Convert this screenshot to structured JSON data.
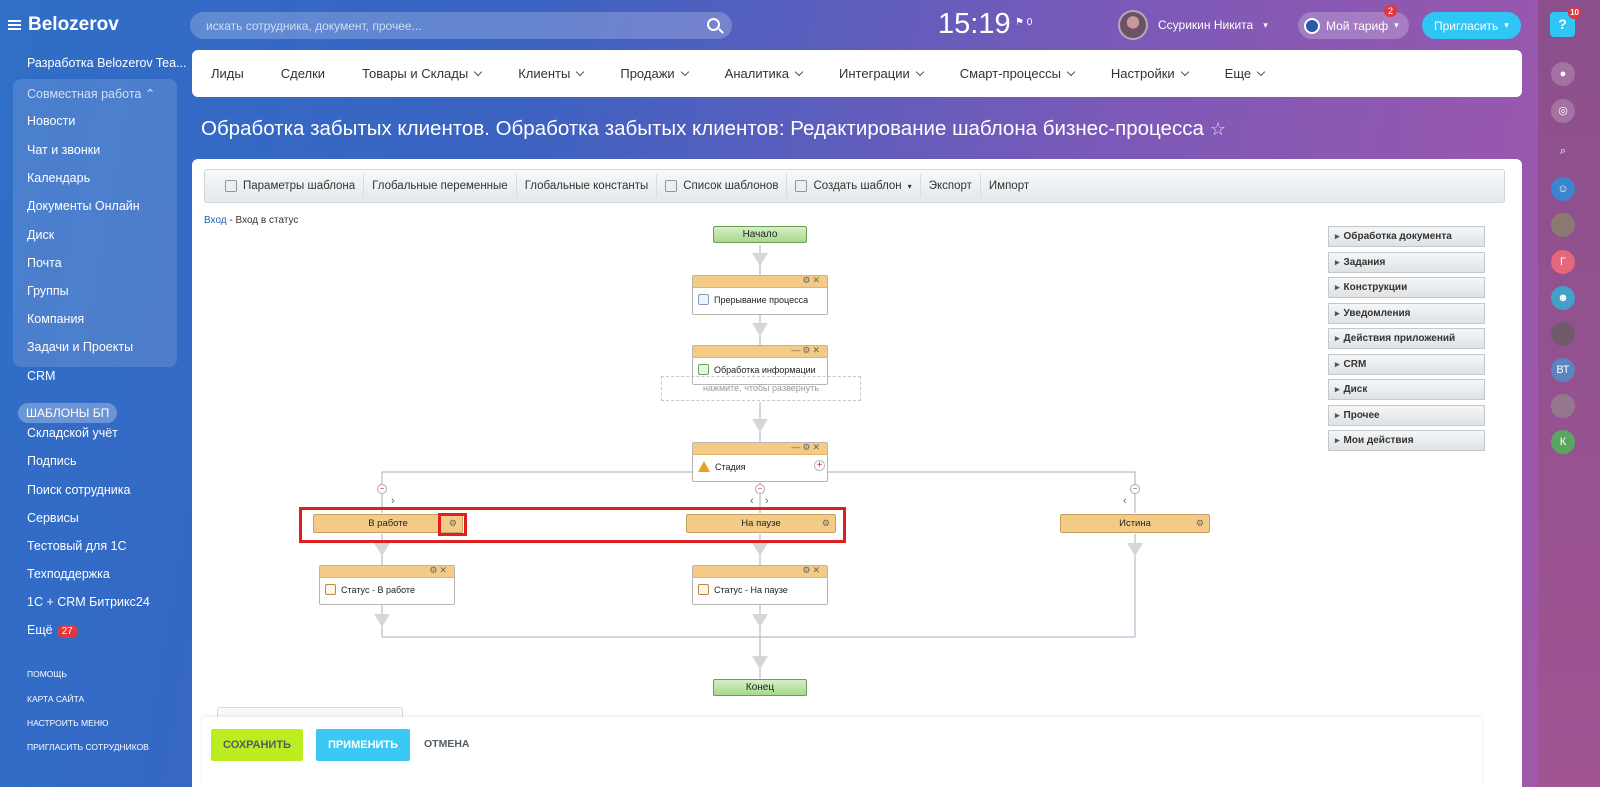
{
  "app": {
    "logo": "Belozerov"
  },
  "sidebar": {
    "items": [
      {
        "label": "Разработка Belozerov Tea..."
      },
      {
        "label": "Совместная работа"
      },
      {
        "label": "Новости"
      },
      {
        "label": "Чат и звонки"
      },
      {
        "label": "Календарь"
      },
      {
        "label": "Документы Онлайн"
      },
      {
        "label": "Диск"
      },
      {
        "label": "Почта"
      },
      {
        "label": "Группы"
      },
      {
        "label": "Компания"
      },
      {
        "label": "Задачи и Проекты"
      },
      {
        "label": "CRM"
      },
      {
        "label": "ШАБЛОНЫ БП"
      },
      {
        "label": "Складской учёт"
      },
      {
        "label": "Подпись"
      },
      {
        "label": "Поиск сотрудника"
      },
      {
        "label": "Сервисы"
      },
      {
        "label": "Тестовый для 1С"
      },
      {
        "label": "Техподдержка"
      },
      {
        "label": "1С + CRM Битрикс24"
      },
      {
        "label": "Ещё",
        "badge": "27"
      }
    ],
    "footer_links": [
      "ПОМОЩЬ",
      "КАРТА САЙТА",
      "НАСТРОИТЬ МЕНЮ",
      "ПРИГЛАСИТЬ СОТРУДНИКОВ"
    ]
  },
  "header": {
    "search_placeholder": "искать сотрудника, документ, прочее...",
    "time": "15:19",
    "flag_count": "0",
    "user_name": "Ссурикин Никита",
    "tariff_label": "Мой тариф",
    "tariff_badge": "2",
    "invite_label": "Пригласить"
  },
  "rail": {
    "help_badge": "10",
    "avatars": [
      "Г",
      "ВТ",
      "К"
    ]
  },
  "topnav": {
    "items": [
      {
        "label": "Лиды",
        "dropdown": false
      },
      {
        "label": "Сделки",
        "dropdown": false
      },
      {
        "label": "Товары и Склады",
        "dropdown": true
      },
      {
        "label": "Клиенты",
        "dropdown": true
      },
      {
        "label": "Продажи",
        "dropdown": true
      },
      {
        "label": "Аналитика",
        "dropdown": true
      },
      {
        "label": "Интеграции",
        "dropdown": true
      },
      {
        "label": "Смарт-процессы",
        "dropdown": true
      },
      {
        "label": "Настройки",
        "dropdown": true
      },
      {
        "label": "Еще",
        "dropdown": true
      }
    ]
  },
  "page": {
    "title": "Обработка забытых клиентов. Обработка забытых клиентов: Редактирование шаблона бизнес-процесса"
  },
  "toolbar": {
    "items": [
      "Параметры шаблона",
      "Глобальные переменные",
      "Глобальные константы",
      "Список шаблонов",
      "Создать шаблон",
      "Экспорт",
      "Импорт"
    ]
  },
  "breadcrumb": {
    "link": "Вход",
    "separator": " - ",
    "current": "Вход в статус"
  },
  "palette": {
    "groups": [
      "Обработка документа",
      "Задания",
      "Конструкции",
      "Уведомления",
      "Действия приложений",
      "CRM",
      "Диск",
      "Прочее",
      "Мои действия"
    ]
  },
  "diagram": {
    "start": "Начало",
    "end": "Конец",
    "activities": {
      "interrupt": "Прерывание процесса",
      "info": "Обработка информации",
      "expand_hint": "нажмите, чтобы развернуть",
      "stage": "Стадия",
      "status_work": "Статус - В работе",
      "status_pause": "Статус - На паузе"
    },
    "branches": [
      "В работе",
      "На паузе",
      "Истина"
    ]
  },
  "footer": {
    "save": "СОХРАНИТЬ",
    "apply": "ПРИМЕНИТЬ",
    "cancel": "ОТМЕНА"
  },
  "colors": {
    "accent_green": "#bbed21",
    "accent_blue": "#3bc8f5",
    "highlight_red": "#e01f1f",
    "activity_header": "#f4cb86"
  }
}
